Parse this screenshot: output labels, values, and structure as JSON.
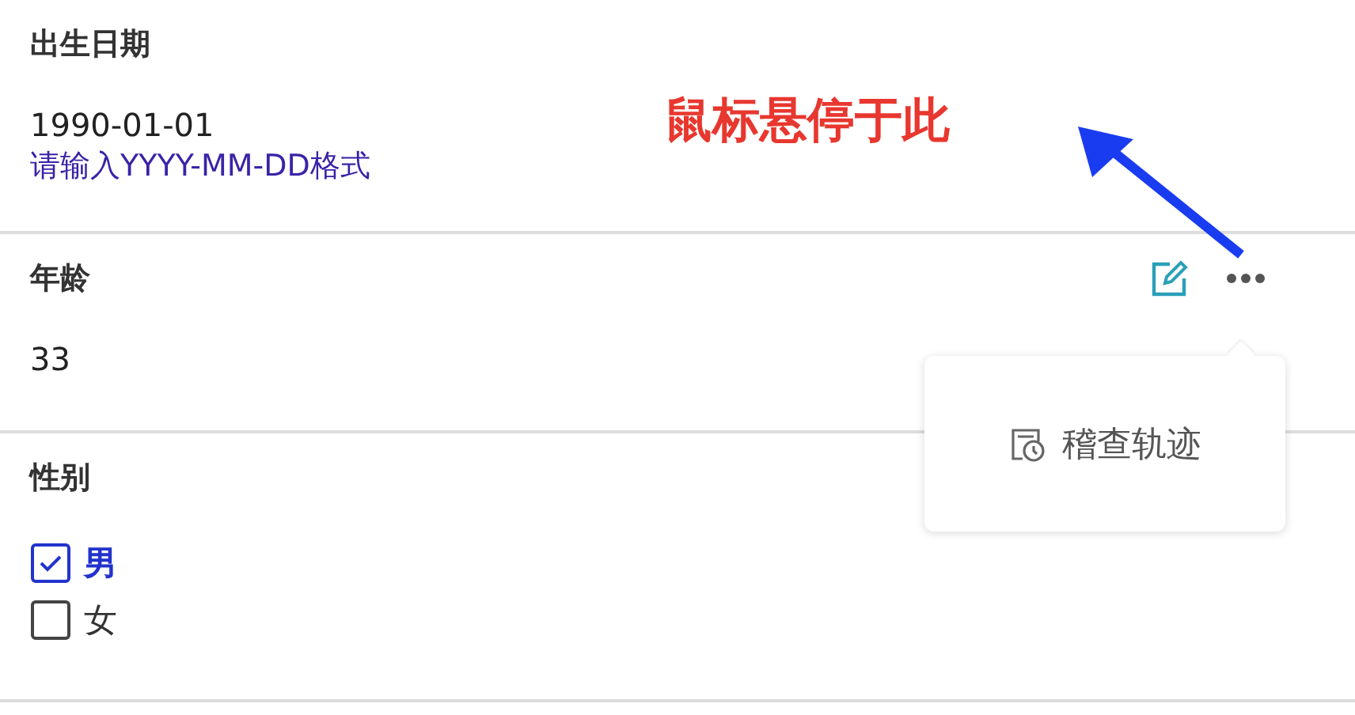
{
  "fields": [
    {
      "kind": "date",
      "label": "出生日期",
      "value": "1990-01-01",
      "hint": "请输入YYYY-MM-DD格式"
    },
    {
      "kind": "number",
      "label": "年龄",
      "value": "33",
      "actions": true
    },
    {
      "kind": "checkbox",
      "label": "性别",
      "options": [
        {
          "label": "男",
          "checked": true
        },
        {
          "label": "女",
          "checked": false
        }
      ]
    }
  ],
  "popup_menu": {
    "items": [
      {
        "label": "稽查轨迹"
      }
    ]
  },
  "annotation": {
    "text": "鼠标悬停于此"
  }
}
